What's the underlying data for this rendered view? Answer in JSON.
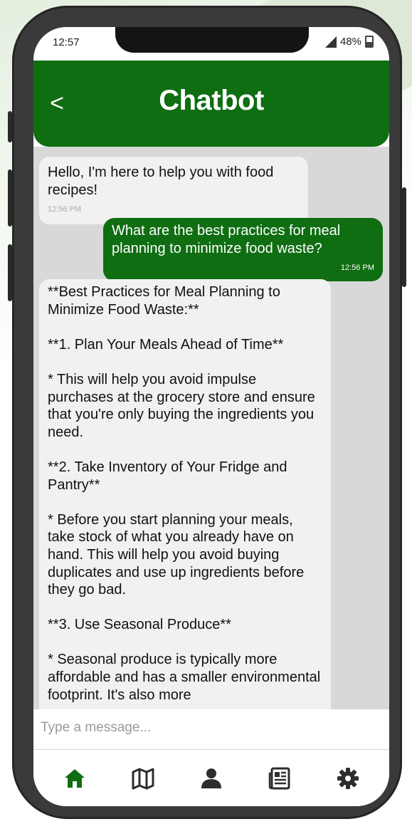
{
  "status_bar": {
    "time": "12:57",
    "battery": "48%"
  },
  "header": {
    "title": "Chatbot",
    "back_label": "<"
  },
  "messages": [
    {
      "sender": "bot",
      "text": "Hello, I'm here to help you with food recipes!",
      "time": "12:56 PM"
    },
    {
      "sender": "user",
      "text": "What are the best practices for meal planning to minimize food waste?",
      "time": "12:56 PM"
    },
    {
      "sender": "bot",
      "text": "**Best Practices for Meal Planning to Minimize Food Waste:**\n\n**1. Plan Your Meals Ahead of Time**\n\n* This will help you avoid impulse purchases at the grocery store and ensure that you're only buying the ingredients you need.\n\n**2. Take Inventory of Your Fridge and Pantry**\n\n* Before you start planning your meals, take stock of what you already have on hand. This will help you avoid buying duplicates and use up ingredients before they go bad.\n\n**3. Use Seasonal Produce**\n\n* Seasonal produce is typically more affordable and has a smaller environmental footprint. It's also more"
    }
  ],
  "composer": {
    "placeholder": "Type a message..."
  },
  "bottom_nav": [
    {
      "icon": "home-icon",
      "active": true
    },
    {
      "icon": "map-icon",
      "active": false
    },
    {
      "icon": "user-icon",
      "active": false
    },
    {
      "icon": "news-icon",
      "active": false
    },
    {
      "icon": "gear-icon",
      "active": false
    }
  ],
  "colors": {
    "brand": "#0f6d12",
    "chat_bg": "#d8d8d8",
    "bot_bubble": "#f1f1f1",
    "user_bubble": "#0f6d12"
  }
}
